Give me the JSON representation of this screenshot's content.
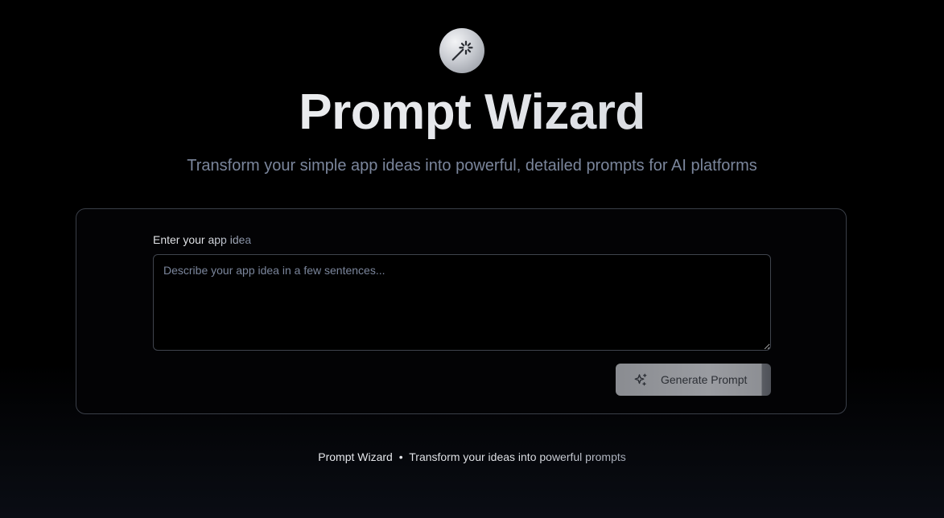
{
  "header": {
    "logo_icon": "magic-wand-icon",
    "title": "Prompt Wizard",
    "subtitle": "Transform your simple app ideas into powerful, detailed prompts for AI platforms"
  },
  "form": {
    "label": "Enter your app idea",
    "input_value": "",
    "input_placeholder": "Describe your app idea in a few sentences...",
    "submit_icon": "sparkles-icon",
    "submit_label": "Generate Prompt"
  },
  "footer": {
    "brand": "Prompt Wizard",
    "separator": "•",
    "tagline": "Transform your ideas into powerful prompts"
  },
  "colors": {
    "background": "#000000",
    "muted_text": "#7b869c",
    "card_border": "#3a3f48",
    "button_bg": "#9a9ca1"
  }
}
